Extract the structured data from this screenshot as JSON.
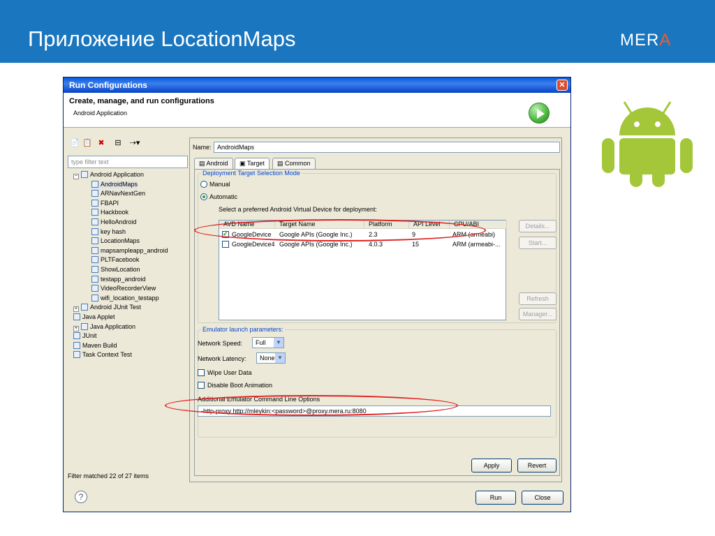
{
  "slide": {
    "title": "Приложение LocationMaps",
    "logo_main": "MER",
    "logo_accent": "A"
  },
  "window": {
    "title": "Run Configurations",
    "close": "✕",
    "header_title": "Create, manage, and run configurations",
    "header_sub": "Android Application"
  },
  "left": {
    "toolbar": [
      "📄",
      "📋",
      "✖",
      "⊟",
      "⇢▾"
    ],
    "filter_placeholder": "type filter text",
    "tree": [
      {
        "label": "Android Application",
        "level": 0,
        "expand": "−"
      },
      {
        "label": "AndroidMaps",
        "level": 1,
        "selected": true
      },
      {
        "label": "ARNavNextGen",
        "level": 1
      },
      {
        "label": "FBAPI",
        "level": 1
      },
      {
        "label": "Hackbook",
        "level": 1
      },
      {
        "label": "HelloAndroid",
        "level": 1
      },
      {
        "label": "key hash",
        "level": 1
      },
      {
        "label": "LocationMaps",
        "level": 1
      },
      {
        "label": "mapsampleapp_android",
        "level": 1
      },
      {
        "label": "PLTFacebook",
        "level": 1
      },
      {
        "label": "ShowLocation",
        "level": 1
      },
      {
        "label": "testapp_android",
        "level": 1
      },
      {
        "label": "VideoRecorderView",
        "level": 1
      },
      {
        "label": "wifi_location_testapp",
        "level": 1
      },
      {
        "label": "Android JUnit Test",
        "level": 0,
        "expand": "+"
      },
      {
        "label": "Java Applet",
        "level": 0
      },
      {
        "label": "Java Application",
        "level": 0,
        "expand": "+"
      },
      {
        "label": "JUnit",
        "level": 0
      },
      {
        "label": "Maven Build",
        "level": 0
      },
      {
        "label": "Task Context Test",
        "level": 0
      }
    ],
    "filter_status": "Filter matched 22 of 27 items"
  },
  "right": {
    "name_label": "Name:",
    "name_value": "AndroidMaps",
    "tabs": [
      "Android",
      "Target",
      "Common"
    ],
    "active_tab": "Target",
    "deploy_legend": "Deployment Target Selection Mode",
    "manual": "Manual",
    "automatic": "Automatic",
    "select_prompt": "Select a preferred Android Virtual Device for deployment:",
    "avd_columns": [
      "AVD Name",
      "Target Name",
      "Platform",
      "API Level",
      "CPU/ABI"
    ],
    "avd_rows": [
      {
        "checked": true,
        "name": "GoogleDevice",
        "target": "Google APIs (Google Inc.)",
        "platform": "2.3",
        "api": "9",
        "cpu": "ARM (armeabi)"
      },
      {
        "checked": false,
        "name": "GoogleDevice4",
        "target": "Google APIs (Google Inc.)",
        "platform": "4.0.3",
        "api": "15",
        "cpu": "ARM (armeabi-..."
      }
    ],
    "side_buttons": [
      "Details...",
      "Start...",
      "Refresh",
      "Manager..."
    ],
    "emu_legend": "Emulator launch parameters:",
    "network_speed_label": "Network Speed:",
    "network_speed": "Full",
    "network_latency_label": "Network Latency:",
    "network_latency": "None",
    "wipe": "Wipe User Data",
    "disable_boot": "Disable Boot Animation",
    "addl_label": "Additional Emulator Command Line Options",
    "addl_value": "-http-proxy http://mleykin:<password>@proxy.mera.ru:8080",
    "apply": "Apply",
    "revert": "Revert"
  },
  "footer": {
    "help": "?",
    "run": "Run",
    "close": "Close"
  },
  "colors": {
    "title_bar": "#1a76be",
    "android_green": "#a4c639",
    "highlight_red": "#e02020"
  }
}
